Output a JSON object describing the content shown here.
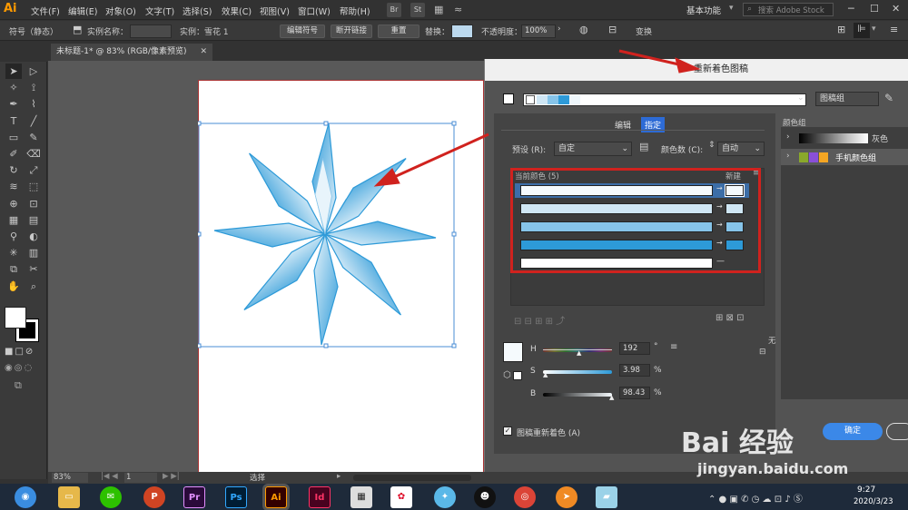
{
  "menubar": {
    "logo": "Ai",
    "items": [
      "文件(F)",
      "编辑(E)",
      "对象(O)",
      "文字(T)",
      "选择(S)",
      "效果(C)",
      "视图(V)",
      "窗口(W)",
      "帮助(H)"
    ],
    "br": "Br",
    "st": "St",
    "workspace": "基本功能",
    "search_placeholder": "搜索 Adobe Stock"
  },
  "controlbar": {
    "symbol_label": "符号（静态）",
    "instance_name_label": "实例名称：",
    "instance_label": "实例：雪花 1",
    "edit_symbol": "编辑符号",
    "break_link": "断开链接",
    "reset": "重置",
    "replace_label": "替换：",
    "opacity_label": "不透明度：",
    "opacity_value": "100%",
    "transform": "变换"
  },
  "document": {
    "tab_title": "未标题-1* @ 83% (RGB/像素预览)"
  },
  "status": {
    "zoom": "83%",
    "page": "1",
    "tool": "选择"
  },
  "dialog": {
    "title": "重新着色图稿",
    "artwork_dropdown": "图稿组",
    "tab_edit": "编辑",
    "tab_assign": "指定",
    "preset_label": "预设 (R):",
    "preset_value": "自定",
    "colors_label": "颜色数 (C):",
    "colors_value": "自动",
    "current_colors_label": "当前颜色 (5)",
    "new_label": "新建",
    "color_groups_label": "颜色组",
    "groups": [
      {
        "name": "灰色"
      },
      {
        "name": "手机颜色组"
      }
    ],
    "h_label": "H",
    "h_value": "192",
    "h_unit": "°",
    "s_label": "S",
    "s_value": "3.98",
    "s_unit": "%",
    "b_label": "B",
    "b_value": "98.43",
    "b_unit": "%",
    "recolor_checkbox": "图稿重新着色 (A)",
    "ok_button": "确定",
    "none_label": "无",
    "rows": [
      {
        "current": "#f5fafd",
        "new": "#f5fafd",
        "selected": true
      },
      {
        "current": "#cfe6f4",
        "new": "#cfe6f4",
        "selected": false
      },
      {
        "current": "#86c4e9",
        "new": "#86c4e9",
        "selected": false
      },
      {
        "current": "#2d9ad8",
        "new": "#2d9ad8",
        "selected": false
      },
      {
        "current": "#ffffff",
        "new": "",
        "selected": false
      }
    ]
  },
  "taskbar": {
    "time": "9:27",
    "date": "2020/3/23",
    "apps": [
      "Pr",
      "Ps",
      "Ai",
      "Id"
    ]
  },
  "watermark": {
    "brand": "Bai 经验",
    "url": "jingyan.baidu.com"
  },
  "colors": {
    "accent": "#2d9ad8",
    "annotation_red": "#d0221e",
    "ai_orange": "#ff9a00"
  }
}
